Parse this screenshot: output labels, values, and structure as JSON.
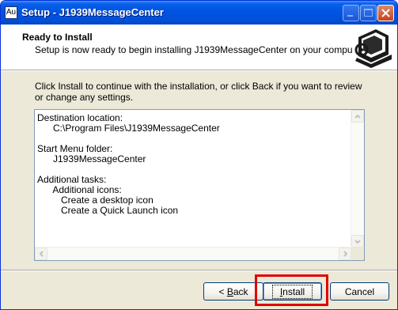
{
  "window": {
    "title": "Setup - J1939MessageCenter",
    "icon_text": "Au",
    "icon_name": "app-icon",
    "titlebar_buttons": [
      "minimize-icon",
      "maximize-icon",
      "close-icon"
    ]
  },
  "header": {
    "title": "Ready to Install",
    "subtitle": "Setup is now ready to begin installing J1939MessageCenter on your computer.",
    "logo_icon": "setup-computer-icon"
  },
  "intro": "Click Install to continue with the installation, or click Back if you want to review or change any settings.",
  "summary": {
    "lines": [
      "Destination location:",
      "      C:\\Program Files\\J1939MessageCenter",
      "",
      "Start Menu folder:",
      "      J1939MessageCenter",
      "",
      "Additional tasks:",
      "      Additional icons:",
      "         Create a desktop icon",
      "         Create a Quick Launch icon"
    ]
  },
  "buttons": {
    "back_prefix": "< ",
    "back_mnemonic": "B",
    "back_rest": "ack",
    "install_mnemonic": "I",
    "install_rest": "nstall",
    "cancel": "Cancel"
  },
  "colors": {
    "titlebar": "#0054e3",
    "highlight": "#e00000",
    "dialog_bg": "#ece9d8"
  }
}
